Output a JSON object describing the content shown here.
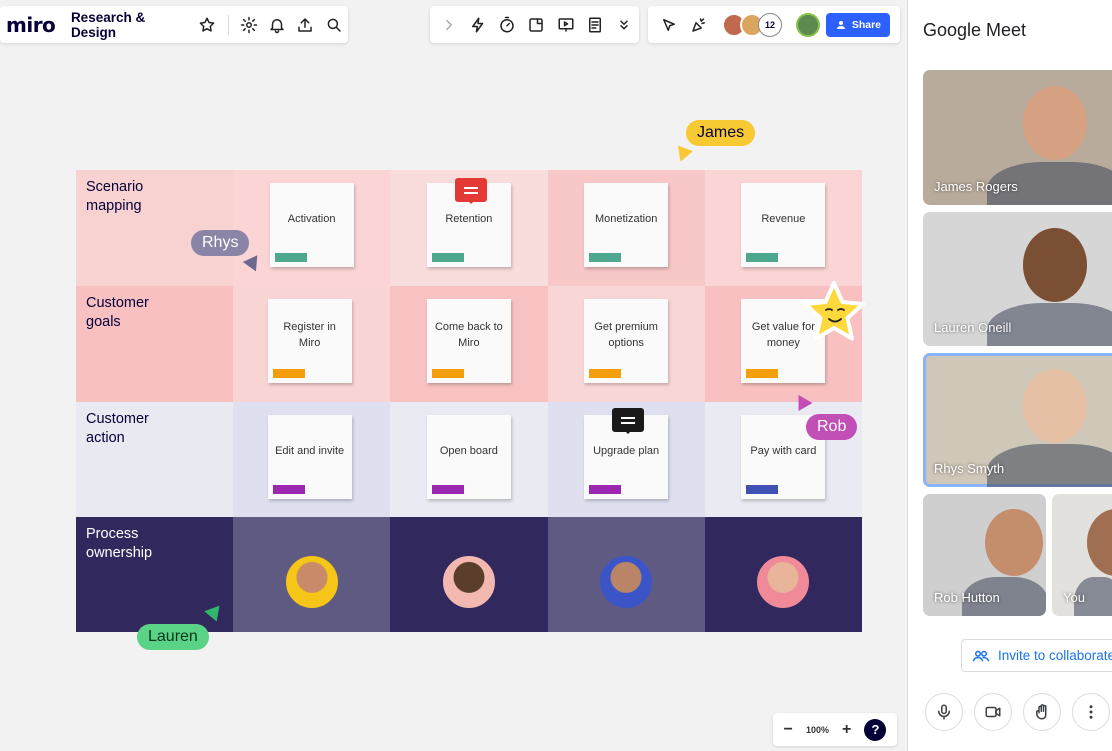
{
  "app": {
    "logo": "miro",
    "board_name": "Research & Design"
  },
  "toolbar": {
    "collab_count": "12",
    "share_label": "Share"
  },
  "board": {
    "rows": [
      {
        "label": "Scenario\nmapping",
        "bg": "#f8d1d1",
        "cells": [
          {
            "text": "Activation",
            "bg": "#fbd5d5",
            "tag": "#4ea78e"
          },
          {
            "text": "Retention",
            "bg": "#f9dcdc",
            "tag": "#4ea78e"
          },
          {
            "text": "Monetization",
            "bg": "#f8c7c7",
            "tag": "#4ea78e"
          },
          {
            "text": "Revenue",
            "bg": "#fbd5d5",
            "tag": "#4ea78e"
          }
        ]
      },
      {
        "label": "Customer\ngoals",
        "bg": "#f8c0c0",
        "cells": [
          {
            "text": "Register in Miro",
            "bg": "#f9d4d4",
            "tag": "#f59e0b"
          },
          {
            "text": "Come back to Miro",
            "bg": "#f8c2c2",
            "tag": "#f59e0b"
          },
          {
            "text": "Get premium options",
            "bg": "#f9d6d6",
            "tag": "#f59e0b"
          },
          {
            "text": "Get value for money",
            "bg": "#f8c0c0",
            "tag": "#f59e0b"
          }
        ]
      },
      {
        "label": "Customer\naction",
        "bg": "#e9e9f2",
        "cells": [
          {
            "text": "Edit and invite",
            "bg": "#dfe0ef",
            "tag": "#9c27b0"
          },
          {
            "text": "Open board",
            "bg": "#eaeaf3",
            "tag": "#9c27b0"
          },
          {
            "text": "Upgrade plan",
            "bg": "#dfe0ef",
            "tag": "#9c27b0"
          },
          {
            "text": "Pay with card",
            "bg": "#eaeaf3",
            "tag": "#3f51b5"
          }
        ]
      },
      {
        "label": "Process\nownership",
        "bg": "#31285d",
        "cells": [
          {
            "bg": "#5f5a81",
            "ring": "#f5c518",
            "skin": "#c98a6a"
          },
          {
            "bg": "#31285d",
            "ring": "#f3b8b0",
            "skin": "#5a3d2b"
          },
          {
            "bg": "#5f5a81",
            "ring": "#3b55c8",
            "skin": "#b98566"
          },
          {
            "bg": "#31285d",
            "ring": "#f08a99",
            "skin": "#e8b59a"
          }
        ]
      }
    ]
  },
  "cursors": [
    {
      "name": "James",
      "color": "#f7c932"
    },
    {
      "name": "Rhys",
      "color": "#8a85a6"
    },
    {
      "name": "Rob",
      "color": "#c24fb6"
    },
    {
      "name": "Lauren",
      "color": "#5ad387"
    }
  ],
  "zoom": {
    "value": "100%",
    "help": "?"
  },
  "meet": {
    "title": "Google Meet",
    "participants": [
      {
        "name": "James Rogers",
        "bg": "#b8ab9c",
        "skin": "#d6a283"
      },
      {
        "name": "Lauren Oneill",
        "bg": "#d6d6d6",
        "skin": "#7b4f34"
      },
      {
        "name": "Rhys Smyth",
        "bg": "#cfc7b8",
        "skin": "#e6c0a4"
      },
      {
        "name": "Rob Hutton",
        "bg": "#cfcfcf",
        "skin": "#c48d6c"
      },
      {
        "name": "You",
        "bg": "#e3e1dd",
        "skin": "#a06f52"
      }
    ],
    "invite": "Invite to collaborate"
  }
}
